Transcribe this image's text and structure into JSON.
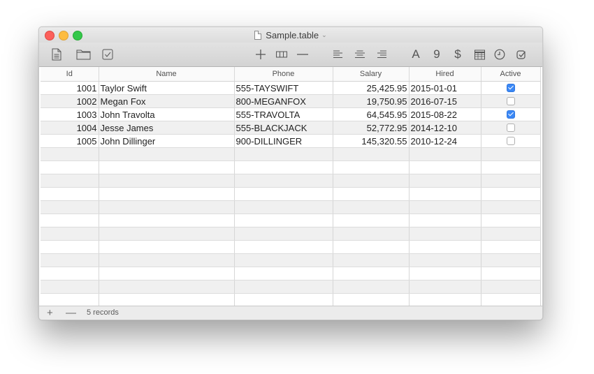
{
  "window": {
    "title": "Sample.table"
  },
  "toolbar": {
    "icons": [
      "document-icon",
      "folder-icon",
      "checkbox-icon",
      "add-icon",
      "column-icon",
      "remove-icon",
      "align-left-icon",
      "align-center-icon",
      "align-right-icon",
      "text-format-icon",
      "number-format-icon",
      "currency-format-icon",
      "date-format-icon",
      "time-format-icon",
      "boolean-format-icon"
    ],
    "text_format_label": "A",
    "number_format_label": "9",
    "currency_format_label": "$"
  },
  "table": {
    "columns": [
      "Id",
      "Name",
      "Phone",
      "Salary",
      "Hired",
      "Active"
    ],
    "rows": [
      {
        "id": "1001",
        "name": "Taylor Swift",
        "phone": "555-TAYSWIFT",
        "salary": "25,425.95",
        "hired": "2015-01-01",
        "active": true
      },
      {
        "id": "1002",
        "name": "Megan Fox",
        "phone": "800-MEGANFOX",
        "salary": "19,750.95",
        "hired": "2016-07-15",
        "active": false
      },
      {
        "id": "1003",
        "name": "John Travolta",
        "phone": "555-TRAVOLTA",
        "salary": "64,545.95",
        "hired": "2015-08-22",
        "active": true
      },
      {
        "id": "1004",
        "name": "Jesse James",
        "phone": "555-BLACKJACK",
        "salary": "52,772.95",
        "hired": "2014-12-10",
        "active": false
      },
      {
        "id": "1005",
        "name": "John Dillinger",
        "phone": "900-DILLINGER",
        "salary": "145,320.55",
        "hired": "2010-12-24",
        "active": false
      }
    ]
  },
  "status": {
    "add_label": "+",
    "remove_label": "—",
    "records": "5 records"
  },
  "colors": {
    "checkbox_accent": "#3b88f5",
    "close": "#fc605b",
    "minimize": "#fdbc40",
    "maximize": "#34c84a"
  }
}
